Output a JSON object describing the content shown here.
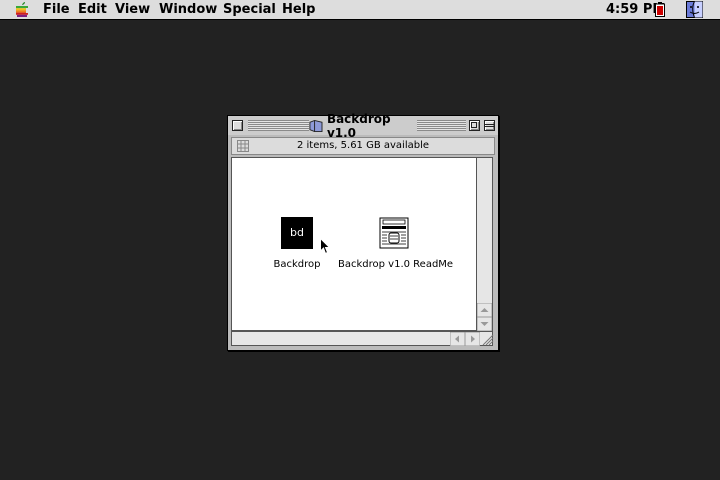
{
  "menubar": {
    "items": [
      {
        "label": "File"
      },
      {
        "label": "Edit"
      },
      {
        "label": "View"
      },
      {
        "label": "Window"
      },
      {
        "label": "Special"
      },
      {
        "label": "Help"
      }
    ],
    "clock": "4:59 PM",
    "apple_icon": "apple-menu-icon",
    "battery_icon": "battery-icon",
    "app_menu_icon": "finder-icon"
  },
  "window": {
    "title": "Backdrop v1.0",
    "info": "2 items, 5.61 GB available",
    "items": [
      {
        "label": "Backdrop",
        "icon": "application-icon",
        "glyph": "bd"
      },
      {
        "label": "Backdrop v1.0 ReadMe",
        "icon": "document-icon"
      }
    ]
  },
  "colors": {
    "desktop": "#222222",
    "menubar": "#dddddd",
    "window_chrome": "#bbbbbb",
    "battery_level": "#cc0000"
  }
}
